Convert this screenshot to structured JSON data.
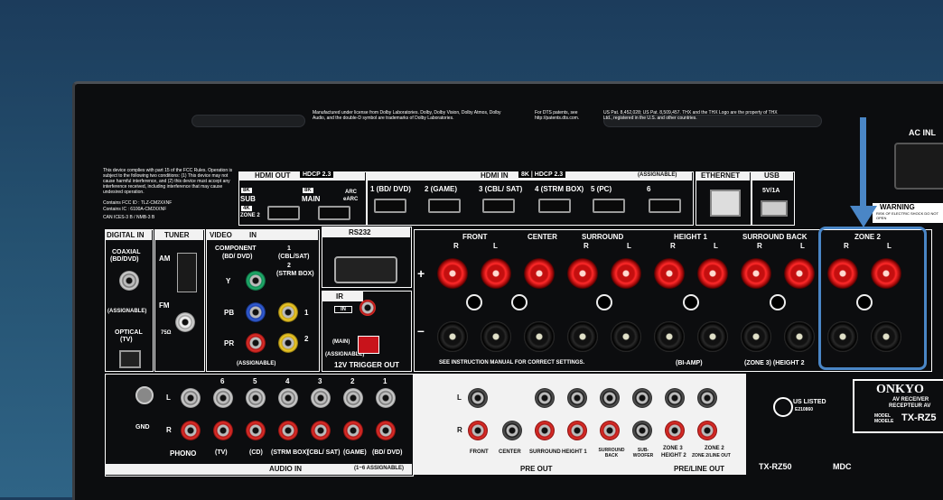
{
  "colors": {
    "background": "#24506f",
    "highlight": "#4a86c6",
    "chassis": "#0c0d0f"
  },
  "legal": {
    "dolby": "Manufactured under license from Dolby Laboratories. Dolby, Dolby Vision, Dolby Atmos, Dolby Audio, and the double-D symbol are trademarks of Dolby Laboratories.",
    "dts": "For DTS patents, see http://patents.dts.com.",
    "thx": "US Pat. 8,452,028; US Pat. 8,509,457. THX and the THX Logo are the property of THX Ltd., registered in the U.S. and other countries.",
    "fcc": "This device complies with part 15 of the FCC Rules. Operation is subject to the following two conditions: (1) This device may not cause harmful interference, and (2) this device must accept any interference received, including interference that may cause undesired operation.",
    "fcc_id": "Contains FCC ID : TLZ-CM2XXNF",
    "ic": "Contains IC : 6100A-CM2XXNF",
    "ices": "CAN ICES-3 B / NMB-3 B"
  },
  "ac_inlet": "AC INL",
  "warning": {
    "title": "WARNING",
    "text": "RISK OF ELECTRIC SHOCK DO NOT OPEN"
  },
  "hdmi_out": {
    "title": "HDMI OUT",
    "badge": "HDCP 2.3",
    "sub_8k": "8K",
    "sub": "SUB",
    "zone_4k": "4K",
    "zone": "ZONE 2",
    "main_8k": "8K",
    "main": "MAIN",
    "arc": "ARC",
    "earc": "eARC"
  },
  "hdmi_in": {
    "title": "HDMI IN",
    "badge": "8K | HDCP 2.3",
    "assignable": "(ASSIGNABLE)",
    "ports": [
      "1 (BD/ DVD)",
      "2 (GAME)",
      "3 (CBL/ SAT)",
      "4 (STRM BOX)",
      "5 (PC)",
      "6"
    ]
  },
  "ethernet": "ETHERNET",
  "usb": {
    "title": "USB",
    "rating": "5V/1A"
  },
  "digital_in": {
    "title": "DIGITAL IN",
    "coaxial": "COAXIAL",
    "coax_src": "(BD/DVD)",
    "assignable": "(ASSIGNABLE)",
    "optical": "OPTICAL",
    "optical_src": "(TV)"
  },
  "tuner": {
    "title": "TUNER",
    "am": "AM",
    "fm": "FM",
    "ohm": "75Ω"
  },
  "video_in": {
    "title": "VIDEO",
    "in": "IN",
    "component": "COMPONENT",
    "component_src": "(BD/ DVD)",
    "y": "Y",
    "pb": "PB",
    "pr": "PR",
    "in1": "1",
    "in1_src": "(CBL/SAT)",
    "in2": "2",
    "in2_src": "(STRM BOX)",
    "n1": "1",
    "n2": "2",
    "assignable": "(ASSIGNABLE)"
  },
  "rs232": "RS232",
  "ir": "IR",
  "ir_in": "IN",
  "trigger": {
    "title": "12V TRIGGER OUT",
    "main": "(MAIN)",
    "assignable": "(ASSIGNABLE)"
  },
  "speakers": {
    "front": "FRONT",
    "center": "CENTER",
    "surround": "SURROUND",
    "height1": "HEIGHT 1",
    "surround_back": "SURROUND BACK",
    "zone2": "ZONE 2",
    "r": "R",
    "l": "L",
    "plus": "+",
    "minus": "–",
    "note": "SEE INSTRUCTION MANUAL FOR CORRECT SETTINGS.",
    "biamp": "(BI-AMP)",
    "zone3": "(ZONE 3) (HEIGHT 2"
  },
  "audio_in": {
    "title": "AUDIO IN",
    "assignable": "(1~6 ASSIGNABLE)",
    "gnd": "GND",
    "l": "L",
    "r": "R",
    "phono": "PHONO",
    "nums": [
      "6",
      "5",
      "4",
      "3",
      "2",
      "1"
    ],
    "srcs": [
      "(TV)",
      "(CD)",
      "(STRM BOX)",
      "(CBL/ SAT)",
      "(GAME)",
      "(BD/ DVD)"
    ]
  },
  "pre_out": {
    "title": "PRE OUT",
    "l": "L",
    "r": "R",
    "cols": [
      "FRONT",
      "CENTER",
      "SURROUND",
      "HEIGHT 1",
      "SURROUND BACK",
      "SUB- WOOFER"
    ]
  },
  "pre_line_out": {
    "title": "PRE/LINE OUT",
    "zone3": "ZONE 3",
    "height2": "HEIGHT 2",
    "zone2": "ZONE 2",
    "zone2_sub": "ZONE 2/LINE OUT"
  },
  "ul": {
    "text": "US LISTED",
    "code": "E210860"
  },
  "brand": {
    "name": "ONKYO",
    "line1": "AV RECEIVER",
    "line2": "RECEPTEUR AV",
    "model_label": "MODEL MODELE",
    "model": "TX-RZ5"
  },
  "model_bottom": "TX-RZ50",
  "mdc": "MDC"
}
